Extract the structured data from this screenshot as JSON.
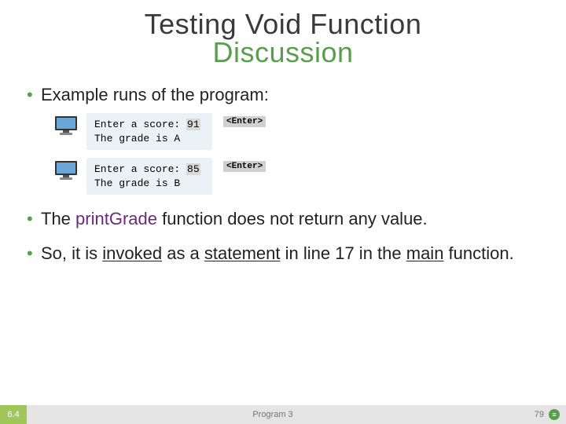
{
  "title": {
    "line1": "Testing Void Function",
    "line2": "Discussion"
  },
  "bullets": {
    "b1": "Example runs of the program:",
    "b2_pre": "The ",
    "b2_fn": "printGrade",
    "b2_post": " function does not return any value.",
    "b3_pre": "So, it is ",
    "b3_u1": "invoked",
    "b3_mid1": " as a ",
    "b3_u2": "statement",
    "b3_mid2": " in line 17 in the ",
    "b3_u3": "main",
    "b3_post": " function."
  },
  "runs": [
    {
      "prompt": "Enter a score: ",
      "input": "91",
      "result": "The grade is A",
      "enter": "<Enter>"
    },
    {
      "prompt": "Enter a score: ",
      "input": "85",
      "result": "The grade is B",
      "enter": "<Enter>"
    }
  ],
  "footer": {
    "section": "6.4",
    "program": "Program 3",
    "page": "79"
  }
}
